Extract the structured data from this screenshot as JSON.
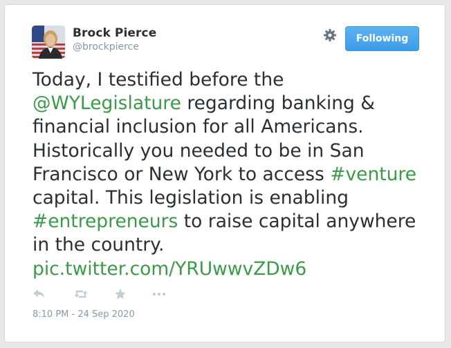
{
  "user": {
    "name": "Brock Pierce",
    "handle": "@brockpierce"
  },
  "follow_button": {
    "label": "Following"
  },
  "tweet": {
    "segments": [
      {
        "text": "Today, I testified before the ",
        "link": false
      },
      {
        "text": "@WYLegislature",
        "link": true
      },
      {
        "text": " regarding banking & financial inclusion for all Americans. Historically you needed to be in San Francisco or New York to access ",
        "link": false
      },
      {
        "text": "#venture",
        "link": true
      },
      {
        "text": " capital. This legislation is enabling ",
        "link": false
      },
      {
        "text": "#entrepreneurs",
        "link": true
      },
      {
        "text": " to raise capital anywhere in the country. ",
        "link": false
      },
      {
        "text": "pic.twitter.com/YRUwwvZDw6",
        "link": true
      }
    ]
  },
  "actions": {
    "icons": [
      "reply-icon",
      "retweet-icon",
      "favorite-icon",
      "more-icon"
    ]
  },
  "timestamp": "8:10 PM - 24 Sep 2020",
  "colors": {
    "link": "#3a9a47",
    "button": "#55acee",
    "text": "#292f33",
    "muted": "#8899a6",
    "icon": "#c5cdd3"
  }
}
